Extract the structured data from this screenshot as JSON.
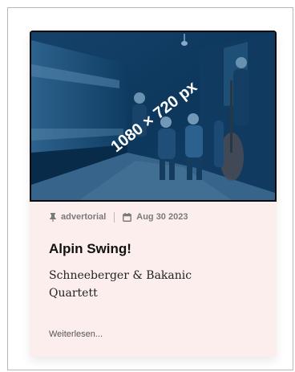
{
  "post": {
    "image_placeholder_label": "1080 × 720 px",
    "category": "advertorial",
    "date": "Aug 30 2023",
    "title": "Alpin Swing!",
    "subtitle": "Schneeberger & Bakanic Quartett",
    "read_more": "Weiterlesen..."
  },
  "icons": {
    "category": "pin-icon",
    "date": "calendar-icon"
  },
  "colors": {
    "card_background": "#fdeeee",
    "image_tint": "#0c4f86",
    "meta_text": "#7a7a7a",
    "title_text": "#111111"
  }
}
